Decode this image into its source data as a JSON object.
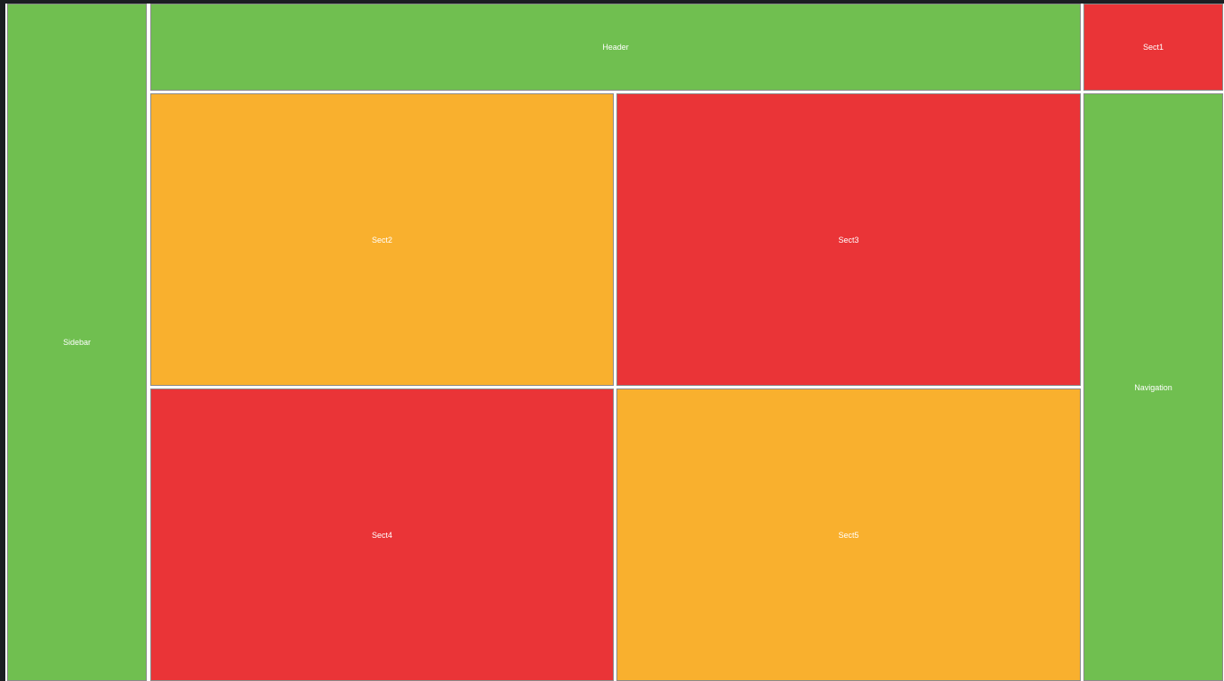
{
  "colors": {
    "green": "#70bf50",
    "red": "#ea3437",
    "orange": "#f9b02e",
    "background": "#1b1e22"
  },
  "layout": {
    "sidebar": {
      "label": "Sidebar"
    },
    "header": {
      "label": "Header"
    },
    "sect1": {
      "label": "Sect1"
    },
    "sect2": {
      "label": "Sect2"
    },
    "sect3": {
      "label": "Sect3"
    },
    "navigation": {
      "label": "Navigation"
    },
    "sect4": {
      "label": "Sect4"
    },
    "sect5": {
      "label": "Sect5"
    }
  }
}
